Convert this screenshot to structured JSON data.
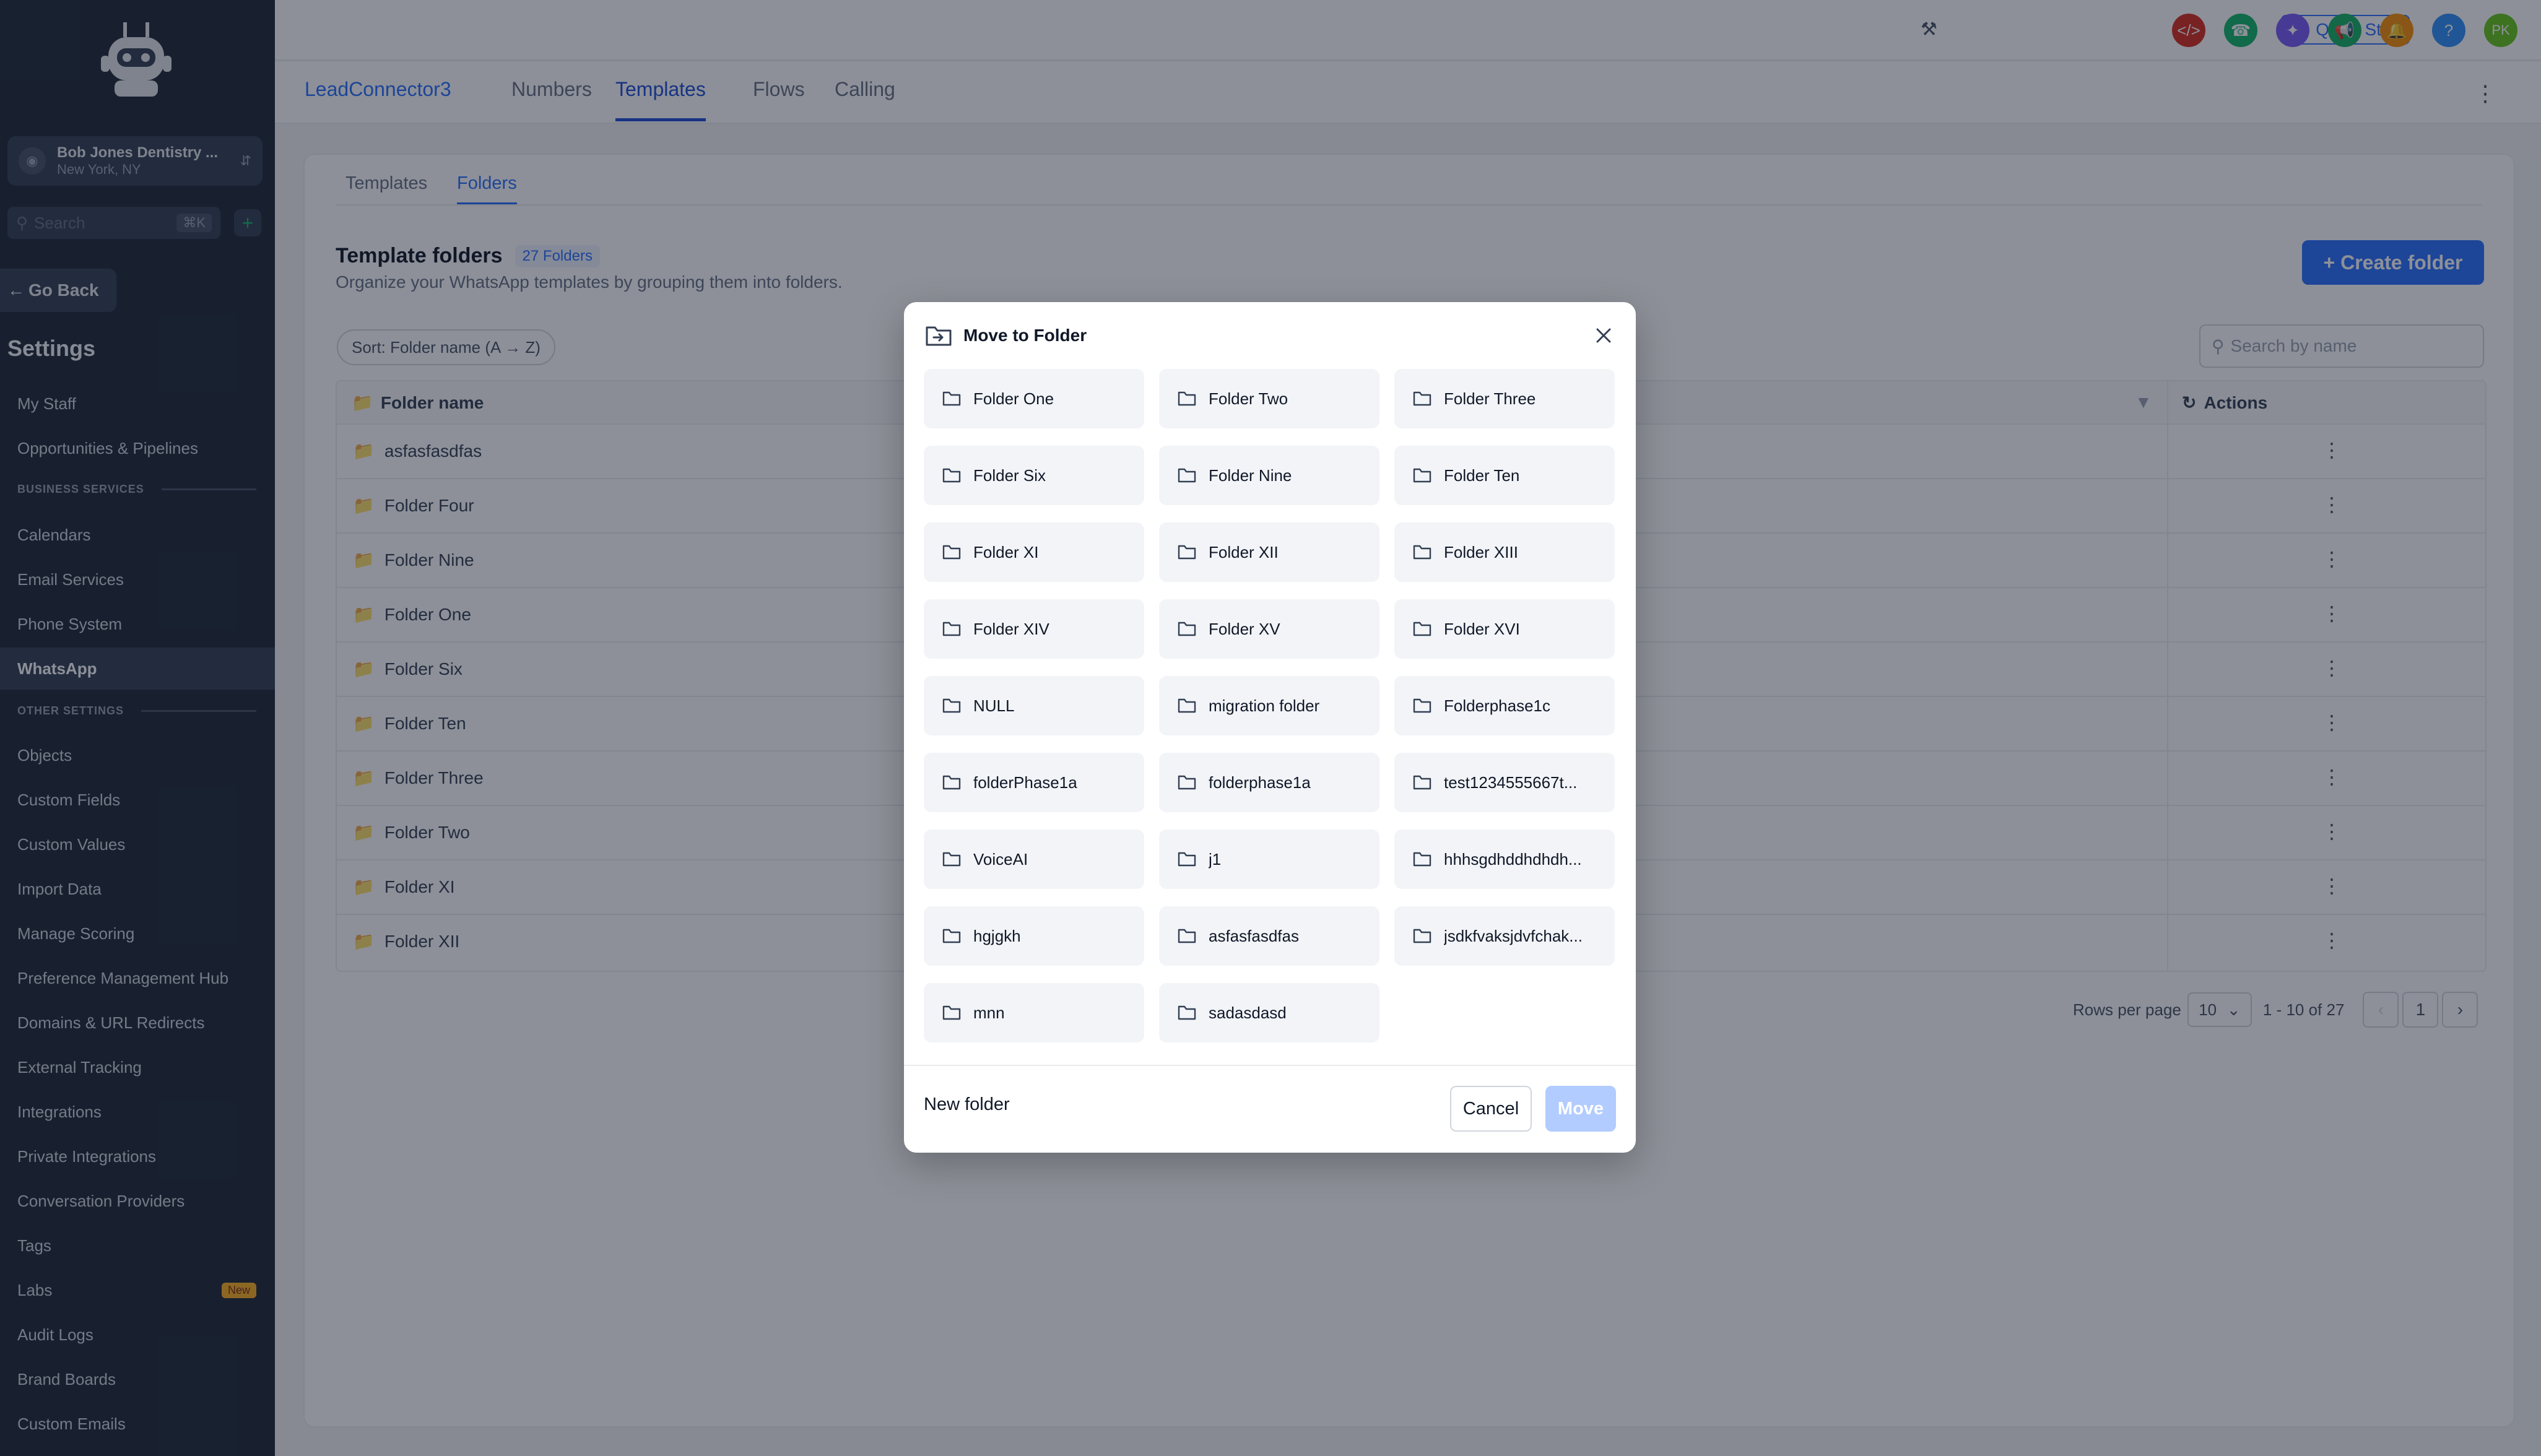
{
  "sidebar": {
    "location_name": "Bob Jones Dentistry ...",
    "location_address": "New York, NY",
    "search_placeholder": "Search",
    "search_shortcut": "⌘K",
    "go_back": "Go Back",
    "title": "Settings",
    "items_top": [
      "My Staff",
      "Opportunities & Pipelines"
    ],
    "section_business": "BUSINESS SERVICES",
    "items_business": [
      "Calendars",
      "Email Services",
      "Phone System",
      "WhatsApp"
    ],
    "section_other": "OTHER SETTINGS",
    "items_other": [
      "Objects",
      "Custom Fields",
      "Custom Values",
      "Import Data",
      "Manage Scoring",
      "Preference Management Hub",
      "Domains & URL Redirects",
      "External Tracking",
      "Integrations",
      "Private Integrations",
      "Conversation Providers",
      "Tags",
      "Labs",
      "Audit Logs",
      "Brand Boards",
      "Custom Emails"
    ],
    "labs_badge": "New"
  },
  "topbar": {
    "quick_start": "Quick Start",
    "avatar_initials": "PK"
  },
  "tabs": {
    "brand": "LeadConnector3",
    "items": [
      "Numbers",
      "Templates",
      "Flows",
      "Calling"
    ],
    "active": "Templates"
  },
  "page": {
    "subtabs": [
      "Templates",
      "Folders"
    ],
    "title": "Template folders",
    "count": "27 Folders",
    "description": "Organize your WhatsApp templates by grouping them into folders.",
    "create_button": "+ Create folder",
    "sort_label": "Sort: Folder name (A → Z)",
    "search_placeholder": "Search by name",
    "col_folder": "Folder name",
    "col_actions": "Actions",
    "rows": [
      "asfasfasdfas",
      "Folder Four",
      "Folder Nine",
      "Folder One",
      "Folder Six",
      "Folder Ten",
      "Folder Three",
      "Folder Two",
      "Folder XI",
      "Folder XII"
    ],
    "rows_per_page_label": "Rows per page",
    "rows_per_page": "10",
    "range": "1 - 10 of 27",
    "page_number": "1"
  },
  "modal": {
    "title": "Move to Folder",
    "folders": [
      "Folder One",
      "Folder Two",
      "Folder Three",
      "Folder Six",
      "Folder Nine",
      "Folder Ten",
      "Folder XI",
      "Folder XII",
      "Folder XIII",
      "Folder XIV",
      "Folder XV",
      "Folder XVI",
      "NULL",
      "migration folder",
      "Folderphase1c",
      "folderPhase1a",
      "folderphase1a",
      "test1234555667t...",
      "VoiceAI",
      "j1",
      "hhhsgdhddhdhdh...",
      "hgjgkh",
      "asfasfasdfas",
      "jsdkfvaksjdvfchak...",
      "mnn",
      "sadasdasd"
    ],
    "new_folder": "New folder",
    "cancel": "Cancel",
    "move": "Move"
  },
  "colors": {
    "primary": "#2970ff",
    "sidebar_bg": "#1f2937",
    "move_disabled": "#b2ccff"
  }
}
